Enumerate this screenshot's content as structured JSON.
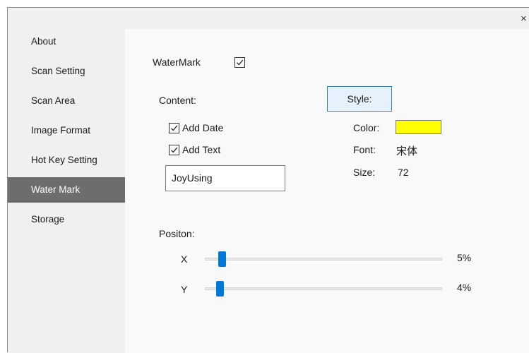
{
  "window": {
    "close_glyph": "×"
  },
  "sidebar": {
    "items": [
      {
        "label": "About"
      },
      {
        "label": "Scan Setting"
      },
      {
        "label": "Scan Area"
      },
      {
        "label": "Image Format"
      },
      {
        "label": "Hot Key Setting"
      },
      {
        "label": "Water Mark",
        "selected": true
      },
      {
        "label": "Storage"
      }
    ]
  },
  "watermark": {
    "label": "WaterMark",
    "checked": true
  },
  "content_section": {
    "label": "Content:",
    "add_date": {
      "label": "Add Date",
      "checked": true
    },
    "add_text": {
      "label": "Add Text",
      "checked": true
    },
    "text_value": "JoyUsing"
  },
  "style_section": {
    "button_label": "Style:",
    "color_label": "Color:",
    "color_value": "#ffff00",
    "font_label": "Font:",
    "font_value": "宋体",
    "size_label": "Size:",
    "size_value": "72"
  },
  "position_section": {
    "label": "Positon:",
    "x": {
      "label": "X",
      "value_text": "5%",
      "value": 0.05
    },
    "y": {
      "label": "Y",
      "value_text": "4%",
      "value": 0.04
    }
  },
  "colors": {
    "accent": "#0078d7",
    "selected_nav": "#6d6d6d"
  }
}
